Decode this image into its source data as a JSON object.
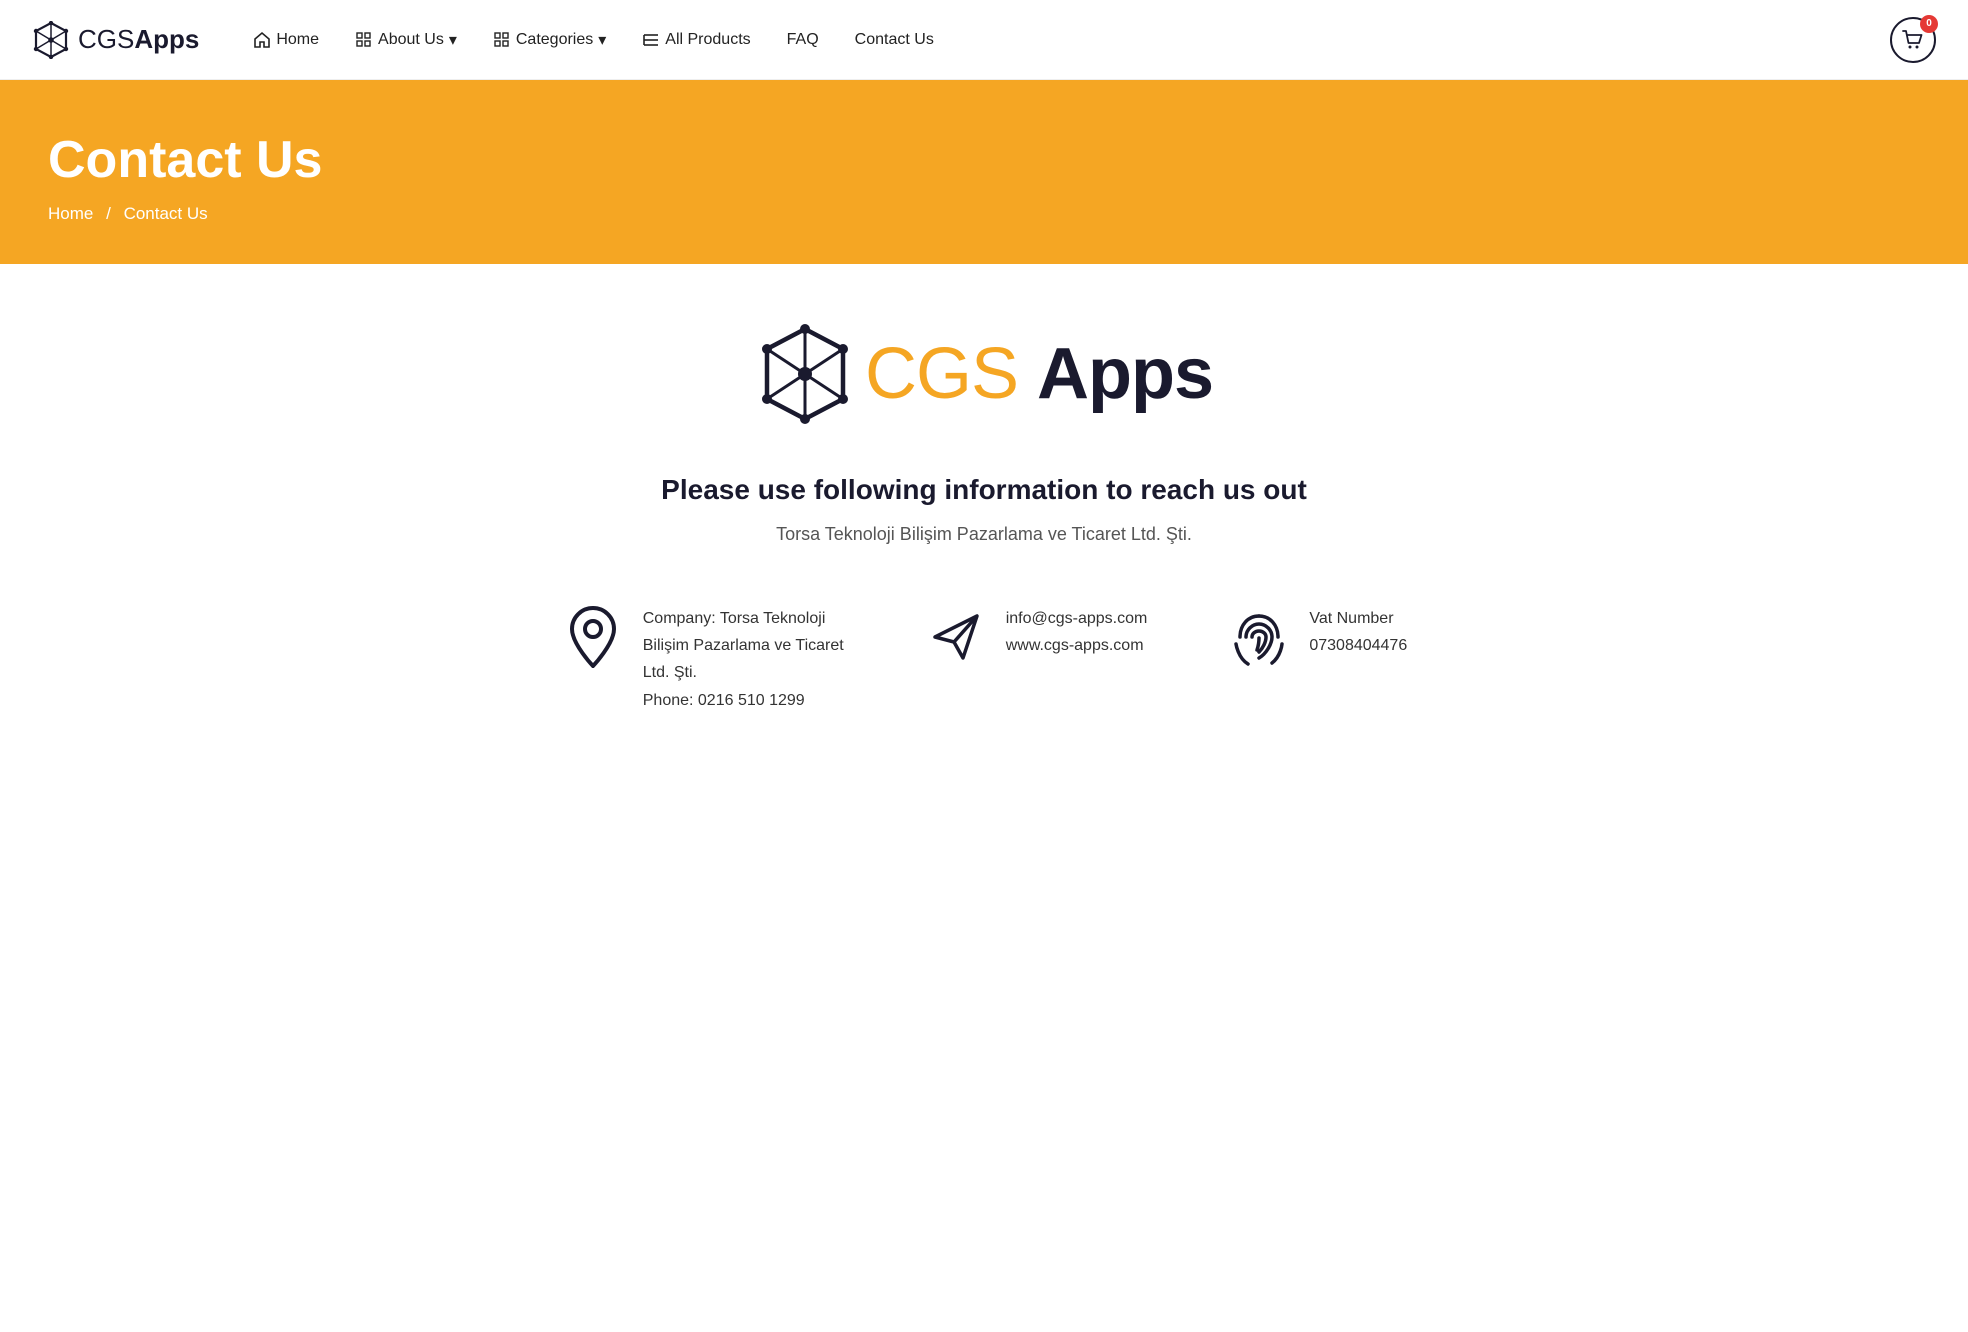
{
  "brand": {
    "name_cgs": "CGS",
    "name_apps": "Apps"
  },
  "nav": {
    "items": [
      {
        "id": "home",
        "label": "Home",
        "icon": "home",
        "has_dropdown": false
      },
      {
        "id": "about",
        "label": "About Us",
        "icon": "grid",
        "has_dropdown": true
      },
      {
        "id": "categories",
        "label": "Categories",
        "icon": "grid",
        "has_dropdown": true
      },
      {
        "id": "all-products",
        "label": "All Products",
        "icon": "list",
        "has_dropdown": false
      },
      {
        "id": "faq",
        "label": "FAQ",
        "icon": null,
        "has_dropdown": false
      },
      {
        "id": "contact",
        "label": "Contact Us",
        "icon": null,
        "has_dropdown": false
      }
    ],
    "cart_count": "0"
  },
  "hero": {
    "title": "Contact Us",
    "breadcrumb_home": "Home",
    "breadcrumb_current": "Contact Us"
  },
  "content": {
    "info_heading": "Please use following information to reach us out",
    "company_name": "Torsa Teknoloji Bilişim Pazarlama ve Ticaret Ltd. Şti.",
    "cards": [
      {
        "id": "address",
        "icon": "location",
        "lines": [
          "Company: Torsa Teknoloji",
          "Bilişim Pazarlama ve Ticaret",
          "Ltd. Şti.",
          "Phone: 0216 510 1299"
        ]
      },
      {
        "id": "email",
        "icon": "send",
        "lines": [
          "info@cgs-apps.com",
          "www.cgs-apps.com"
        ]
      },
      {
        "id": "vat",
        "icon": "fingerprint",
        "lines": [
          "Vat Number",
          "07308404476"
        ]
      }
    ]
  }
}
